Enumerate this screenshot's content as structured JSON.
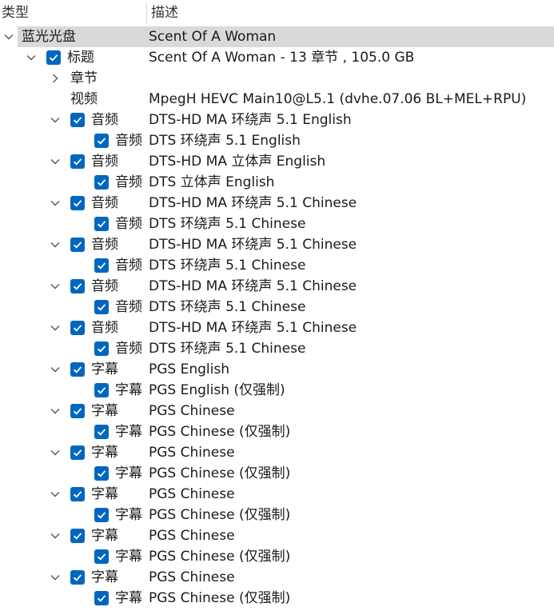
{
  "columns": {
    "type": "类型",
    "description": "描述"
  },
  "rows": [
    {
      "type": "蓝光光盘",
      "desc": "Scent Of A Woman",
      "level": 0,
      "toggle": "expanded",
      "checkbox": false,
      "selected": true
    },
    {
      "type": "标题",
      "desc": "Scent Of A Woman - 13 章节 , 105.0 GB",
      "level": 1,
      "toggle": "expanded",
      "checkbox": true
    },
    {
      "type": "章节",
      "desc": "",
      "level": 2,
      "toggle": "collapsed",
      "checkbox": false
    },
    {
      "type": "视频",
      "desc": "MpegH HEVC Main10@L5.1 (dvhe.07.06 BL+MEL+RPU)",
      "level": 2,
      "toggle": "none",
      "checkbox": false
    },
    {
      "type": "音频",
      "desc": "DTS-HD MA 环绕声 5.1 English",
      "level": 2,
      "toggle": "expanded",
      "checkbox": true
    },
    {
      "type": "音频",
      "desc": "DTS 环绕声 5.1 English",
      "level": 3,
      "toggle": "none",
      "checkbox": true
    },
    {
      "type": "音频",
      "desc": "DTS-HD MA 立体声 English",
      "level": 2,
      "toggle": "expanded",
      "checkbox": true
    },
    {
      "type": "音频",
      "desc": "DTS 立体声 English",
      "level": 3,
      "toggle": "none",
      "checkbox": true
    },
    {
      "type": "音频",
      "desc": "DTS-HD MA 环绕声 5.1 Chinese",
      "level": 2,
      "toggle": "expanded",
      "checkbox": true
    },
    {
      "type": "音频",
      "desc": "DTS 环绕声 5.1 Chinese",
      "level": 3,
      "toggle": "none",
      "checkbox": true
    },
    {
      "type": "音频",
      "desc": "DTS-HD MA 环绕声 5.1 Chinese",
      "level": 2,
      "toggle": "expanded",
      "checkbox": true
    },
    {
      "type": "音频",
      "desc": "DTS 环绕声 5.1 Chinese",
      "level": 3,
      "toggle": "none",
      "checkbox": true
    },
    {
      "type": "音频",
      "desc": "DTS-HD MA 环绕声 5.1 Chinese",
      "level": 2,
      "toggle": "expanded",
      "checkbox": true
    },
    {
      "type": "音频",
      "desc": "DTS 环绕声 5.1 Chinese",
      "level": 3,
      "toggle": "none",
      "checkbox": true
    },
    {
      "type": "音频",
      "desc": "DTS-HD MA 环绕声 5.1 Chinese",
      "level": 2,
      "toggle": "expanded",
      "checkbox": true
    },
    {
      "type": "音频",
      "desc": "DTS 环绕声 5.1 Chinese",
      "level": 3,
      "toggle": "none",
      "checkbox": true
    },
    {
      "type": "字幕",
      "desc": "PGS English",
      "level": 2,
      "toggle": "expanded",
      "checkbox": true
    },
    {
      "type": "字幕",
      "desc": "PGS English  (仅强制)",
      "level": 3,
      "toggle": "none",
      "checkbox": true
    },
    {
      "type": "字幕",
      "desc": "PGS Chinese",
      "level": 2,
      "toggle": "expanded",
      "checkbox": true
    },
    {
      "type": "字幕",
      "desc": "PGS Chinese  (仅强制)",
      "level": 3,
      "toggle": "none",
      "checkbox": true
    },
    {
      "type": "字幕",
      "desc": "PGS Chinese",
      "level": 2,
      "toggle": "expanded",
      "checkbox": true
    },
    {
      "type": "字幕",
      "desc": "PGS Chinese  (仅强制)",
      "level": 3,
      "toggle": "none",
      "checkbox": true
    },
    {
      "type": "字幕",
      "desc": "PGS Chinese",
      "level": 2,
      "toggle": "expanded",
      "checkbox": true
    },
    {
      "type": "字幕",
      "desc": "PGS Chinese  (仅强制)",
      "level": 3,
      "toggle": "none",
      "checkbox": true
    },
    {
      "type": "字幕",
      "desc": "PGS Chinese",
      "level": 2,
      "toggle": "expanded",
      "checkbox": true
    },
    {
      "type": "字幕",
      "desc": "PGS Chinese  (仅强制)",
      "level": 3,
      "toggle": "none",
      "checkbox": true
    },
    {
      "type": "字幕",
      "desc": "PGS Chinese",
      "level": 2,
      "toggle": "expanded",
      "checkbox": true
    },
    {
      "type": "字幕",
      "desc": "PGS Chinese  (仅强制)",
      "level": 3,
      "toggle": "none",
      "checkbox": true
    }
  ],
  "colors": {
    "checkbox": "#0067c0",
    "selection": "#d9d9d9",
    "chevron": "#555555"
  },
  "icons": {
    "expanded": "chevron-down-icon",
    "collapsed": "chevron-right-icon",
    "check": "check-icon"
  }
}
